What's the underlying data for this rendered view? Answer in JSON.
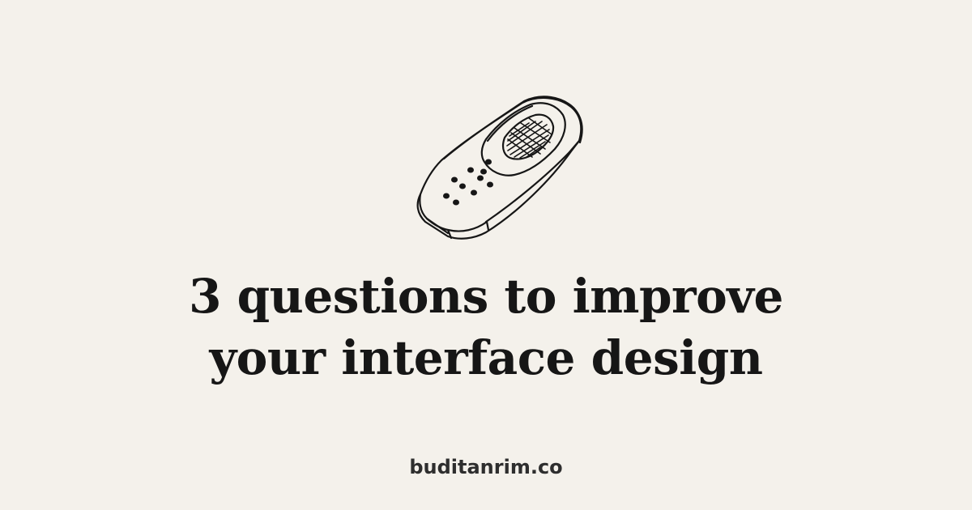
{
  "background_color": "#f4f1eb",
  "text_color": "#161616",
  "illustration": {
    "icon": "mobile-phone-sketch-icon"
  },
  "title": {
    "line1": "3 questions to improve",
    "line2": "your interface design"
  },
  "site": {
    "domain": "buditanrim.co"
  }
}
